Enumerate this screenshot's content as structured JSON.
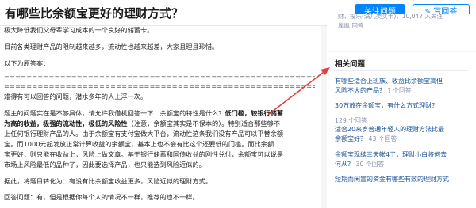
{
  "header": {
    "title": "有哪些比余额宝更好的理财方式？",
    "follow_label": "关注问题",
    "write_label": "写回答"
  },
  "answer": {
    "lines": [
      "极大降低我们父母辈学习成本的一个良好的储蓄卡。",
      "目前各类理财产品的限制越来越多，流动性也越来越差，大家且理且珍惜。",
      "以下为原答案：",
      "================================================================",
      "================================================================",
      "难得有可以回答的问题，潜水多年的人上浮一次。",
      "题主的问题实在是不够具体，请允许我借机回答一下：余额宝的特性是什么？",
      "为高的收益，极强的流动性，极低的风险性（注意，余额宝其实是不保本的）。特别适合那些够不",
      "上任何银行理财产品的人。由于余额宝有支付宝做大平台，流动性这条我们没有产品可以平替余额",
      "宝。而1000元起发放正常计算收益的余额宝，基本上也不会有比这个还要低的门槛。而比余额",
      "宝更好，则只能在收益上，风险上做文章。基于银行储蓄和国债收益的刚性兑付，余额宝可以说是",
      "市场上风险最低的品种了，因此要选择产品，也只能选到风险近似的。",
      "据此，将题目转化为：有没有比余额宝收益更多，风险近似的理财方式。",
      "回答问题：有，但是根据你每个人的情况不一样，推荐的也不一样。"
    ],
    "line7_lead": "题主的问题实在是不够具体，请允许我借机回答一下：余额宝的特性是什么？",
    "line7_bold": "低门槛，较银行储蓄",
    "line8_bold": "为高的收益，极强的流动性，极低的风险性",
    "line8_rest": "（注意，余额宝其实是不保本的）。特别适合那些够不"
  },
  "side_top": {
    "line1": "财，投乐(满几类买卡)，10,047 人关注",
    "line2": "胤胤 回答"
  },
  "related": {
    "title": "相关问题",
    "items": [
      {
        "title_line1": "有哪些适合上班族、收益比余额宝高但",
        "title_line2": "风险不大的产品？",
        "meta": "? 个回答"
      },
      {
        "title_line1": "30万放在余额宝，有什么方式理财？",
        "title_line2": "",
        "meta": "129 个回答"
      },
      {
        "title_line1": "适合20来岁普通年轻人的理财方法比最",
        "title_line2": "余额宝好？",
        "meta": "43 个回答"
      },
      {
        "title_line1": "余额宝现续三天帐4了，理财小白将何去",
        "title_line2": "何从？",
        "meta": "30 个回答"
      },
      {
        "title_line1": "短期而闲置的资金有哪些有效的理财方式",
        "title_line2": "",
        "meta": ""
      }
    ]
  },
  "colors": {
    "accent": "#0084ff",
    "link": "#175199",
    "annotation_arrow": "#e2403f"
  }
}
